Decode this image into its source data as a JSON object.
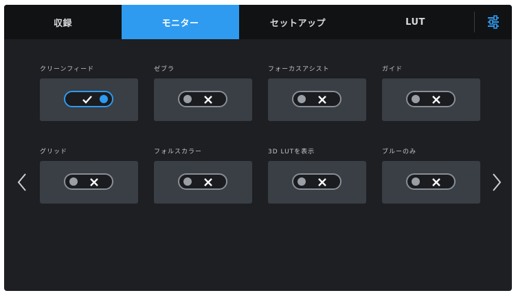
{
  "tabs": [
    {
      "label": "収録",
      "active": false
    },
    {
      "label": "モニター",
      "active": true
    },
    {
      "label": "セットアップ",
      "active": false
    },
    {
      "label": "LUT",
      "active": false
    }
  ],
  "settings_icon": "sliders-icon",
  "toggles": [
    {
      "label": "クリーンフィード",
      "state": "on"
    },
    {
      "label": "ゼブラ",
      "state": "off"
    },
    {
      "label": "フォーカスアシスト",
      "state": "off"
    },
    {
      "label": "ガイド",
      "state": "off"
    },
    {
      "label": "グリッド",
      "state": "off"
    },
    {
      "label": "フォルスカラー",
      "state": "off"
    },
    {
      "label": "3D LUTを表示",
      "state": "off"
    },
    {
      "label": "ブルーのみ",
      "state": "off"
    }
  ],
  "colors": {
    "accent": "#2e9bf0",
    "background": "#1d1f23",
    "tabbar": "#111214",
    "card": "#3a3e45"
  }
}
